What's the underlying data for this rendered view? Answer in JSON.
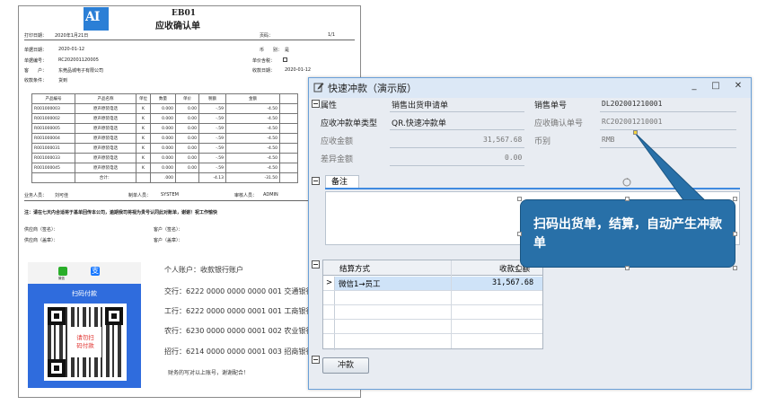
{
  "document": {
    "logo_text": "AI",
    "code": "EB01",
    "title": "应收确认单",
    "print_date_label": "打印日期：",
    "print_date": "2020年1月21日",
    "page_label": "页码：",
    "page": "1/1",
    "doc_date_label": "单据日期：",
    "doc_date": "2020-01-12",
    "currency_label": "币　　别：",
    "currency": "是",
    "doc_no_label": "单据编号：",
    "doc_no": "RC202001120005",
    "unit_price_label": "单价含税：",
    "customer_label": "客　　户：",
    "customer": "东莞品城电子有限公司",
    "receipt_date_label": "收款日期：",
    "receipt_date": "2020-01-12",
    "collection_terms_label": "收款条件：",
    "collection_terms": "货到",
    "table": {
      "headers": [
        "产品编号",
        "产品名称",
        "单位",
        "数量",
        "单价",
        "税额",
        "金额"
      ],
      "rows": [
        [
          "R001000003",
          "原声原装电话",
          "K",
          "0.000",
          "0.00",
          "-.59",
          "-4.50"
        ],
        [
          "R001000002",
          "原声原装电话",
          "K",
          "0.000",
          "0.00",
          "-.59",
          "-4.50"
        ],
        [
          "R001000005",
          "原声原装电话",
          "K",
          "0.000",
          "0.00",
          "-.59",
          "-4.50"
        ],
        [
          "R001000004",
          "原声原装电话",
          "K",
          "0.000",
          "0.00",
          "-.59",
          "-4.50"
        ],
        [
          "R001000031",
          "原声原装电话",
          "K",
          "0.000",
          "0.00",
          "-.59",
          "-4.50"
        ],
        [
          "R001000033",
          "原声原装电话",
          "K",
          "0.000",
          "0.00",
          "-.59",
          "-4.50"
        ],
        [
          "R001000045",
          "原声原装电话",
          "K",
          "0.000",
          "0.00",
          "-.59",
          "-4.50"
        ]
      ],
      "total_label": "合计：",
      "total_qty": ".000",
      "total_tax": "-4.13",
      "total_amount": "-31.50"
    },
    "salesperson_label": "业务人员：",
    "salesperson": "刘可佳",
    "preparer_label": "制单人员：",
    "preparer": "SYSTEM",
    "reviewer_label": "审核人员：",
    "reviewer": "ADMIN",
    "notice": "注：请在七天内合适将于基单回传本公司，逾期我司将视为贵号认同此对账单，谢谢！祝工作愉快",
    "supplier_sign_label": "供应商（签名）：",
    "customer_sign_label": "客户（签名）：",
    "supplier_seal_label": "供应商（盖章）：",
    "customer_seal_label": "客户（盖章）：",
    "pay_wechat": "微信",
    "pay_alipay": "支",
    "pay_panel_title": "扫码付款",
    "qr_caption_1": "请勿扫",
    "qr_caption_2": "码付款",
    "accounts": [
      "个人账户：收款银行账户",
      "交行：6222 0000 0000 0000 001  交通银行",
      "工行：6222 0000 0000 0001 001  工商银行",
      "农行：6230 0000 0000 0001 002  农业银行",
      "招行：6214 0000 0000 0001 003  招商银行"
    ],
    "account_thanks": "财务的写对以上账号，谢谢配合！"
  },
  "dialog": {
    "title": "快速冲款（演示版）",
    "controls": [
      "_",
      "□",
      "✕"
    ],
    "fields": {
      "attribute_label": "属性",
      "attribute_value": "销售出货申请单",
      "sales_no_label": "销售单号",
      "sales_no_value": "DL202001210001",
      "offset_type_label": "应收冲款单类型",
      "offset_type_value": "QR.快速冲款单",
      "receivable_no_label": "应收确认单号",
      "receivable_no_value": "RC202001210001",
      "receivable_amount_label": "应收金额",
      "receivable_amount_value": "31,567.68",
      "currency_label": "币别",
      "currency_value": "RMB",
      "difference_label": "差异金额",
      "difference_value": "0.00"
    },
    "note_tab": "备注",
    "grid": {
      "col_method": "结算方式",
      "col_amount": "收款金额",
      "row_method": "微信1→员工",
      "row_amount": "31,567.68",
      "row_indicator": ">"
    },
    "clear_button": "冲款"
  },
  "callout": {
    "text": "扫码出货单，结算，自动产生冲款单"
  }
}
